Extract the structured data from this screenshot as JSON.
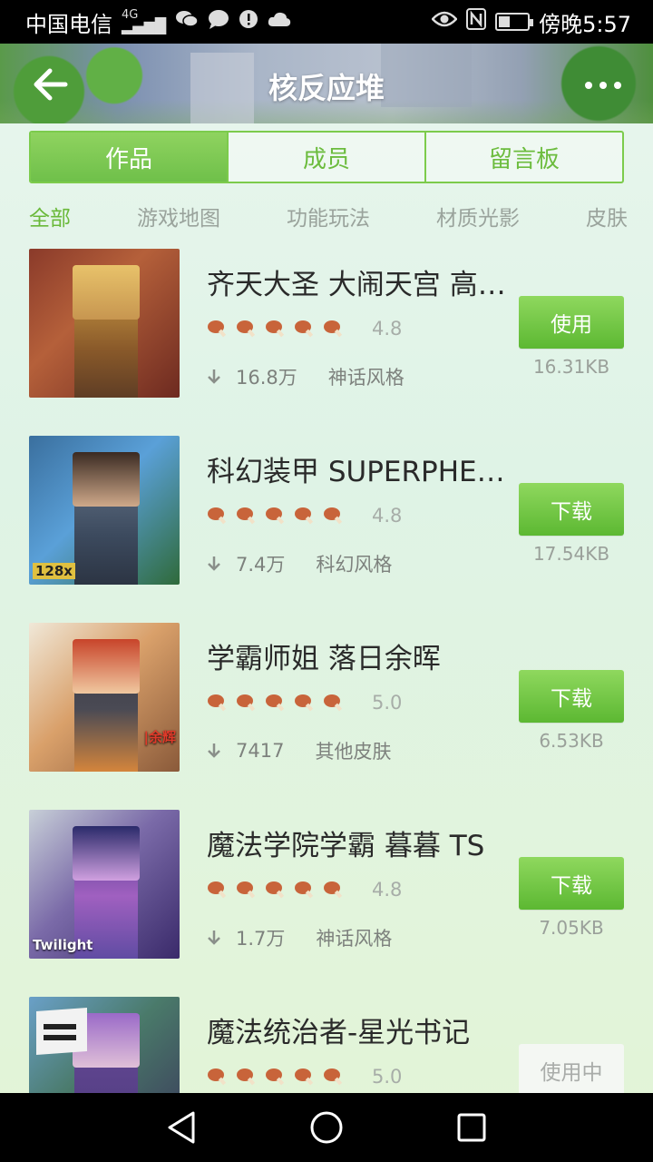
{
  "status_bar": {
    "carrier": "中国电信",
    "network": "4G",
    "time": "傍晚5:57",
    "icons": [
      "wechat-icon",
      "message-icon",
      "alert-icon",
      "cloud-icon",
      "eye-icon",
      "nfc-icon",
      "battery-icon"
    ]
  },
  "header": {
    "title": "核反应堆",
    "back_icon": "arrow-left-icon",
    "more_icon": "more-dots-icon"
  },
  "tabs": [
    {
      "label": "作品",
      "active": true
    },
    {
      "label": "成员",
      "active": false
    },
    {
      "label": "留言板",
      "active": false
    }
  ],
  "categories": [
    {
      "label": "全部",
      "active": true
    },
    {
      "label": "游戏地图",
      "active": false
    },
    {
      "label": "功能玩法",
      "active": false
    },
    {
      "label": "材质光影",
      "active": false
    },
    {
      "label": "皮肤",
      "active": false
    }
  ],
  "items": [
    {
      "name": "齐天大圣 大闹天宫 高…",
      "rating": "4.8",
      "downloads": "16.8万",
      "style": "神话风格",
      "action": "使用",
      "size": "16.31KB",
      "thumb_tag": ""
    },
    {
      "name": "科幻装甲 SUPERPHE…",
      "rating": "4.8",
      "downloads": "7.4万",
      "style": "科幻风格",
      "action": "下载",
      "size": "17.54KB",
      "thumb_tag": "128x"
    },
    {
      "name": "学霸师姐 落日余晖",
      "rating": "5.0",
      "downloads": "7417",
      "style": "其他皮肤",
      "action": "下载",
      "size": "6.53KB",
      "thumb_tag": "|余辉"
    },
    {
      "name": "魔法学院学霸  暮暮 TS",
      "rating": "4.8",
      "downloads": "1.7万",
      "style": "神话风格",
      "action": "下载",
      "size": "7.05KB",
      "thumb_tag": "Twilight"
    },
    {
      "name": "魔法统治者-星光书记",
      "rating": "5.0",
      "downloads": "",
      "style": "",
      "action": "使用中",
      "size": "",
      "thumb_tag": ""
    }
  ],
  "colors": {
    "accent": "#6cbc3e",
    "button_green": "#5cb832",
    "drumstick": "#c8643a"
  },
  "nav_bar": {
    "icons": [
      "back-triangle-icon",
      "home-circle-icon",
      "recents-square-icon"
    ]
  }
}
